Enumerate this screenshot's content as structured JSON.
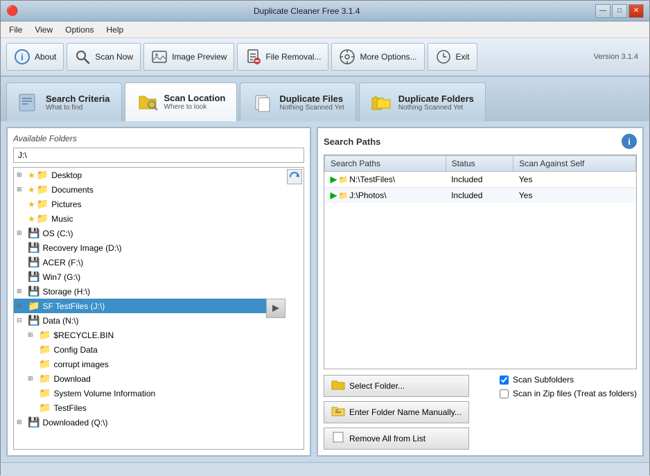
{
  "window": {
    "title": "Duplicate Cleaner Free 3.1.4",
    "version": "Version 3.1.4"
  },
  "titlebar": {
    "icon": "🔴",
    "minimize": "—",
    "maximize": "□",
    "close": "✕"
  },
  "menubar": {
    "items": [
      "File",
      "View",
      "Options",
      "Help"
    ]
  },
  "toolbar": {
    "buttons": [
      {
        "id": "about",
        "icon": "ℹ",
        "label": "About"
      },
      {
        "id": "scan-now",
        "icon": "🔍",
        "label": "Scan Now"
      },
      {
        "id": "image-preview",
        "icon": "🖼",
        "label": "Image Preview"
      },
      {
        "id": "file-removal",
        "icon": "🗑",
        "label": "File Removal..."
      },
      {
        "id": "more-options",
        "icon": "⚙",
        "label": "More Options..."
      },
      {
        "id": "exit",
        "icon": "⏻",
        "label": "Exit"
      }
    ],
    "version": "Version 3.1.4"
  },
  "tabs": [
    {
      "id": "search-criteria",
      "icon": "🖥",
      "title": "Search Criteria",
      "sub": "What to find",
      "active": false
    },
    {
      "id": "scan-location",
      "icon": "📁",
      "title": "Scan Location",
      "sub": "Where to look",
      "active": true
    },
    {
      "id": "duplicate-files",
      "icon": "📄",
      "title": "Duplicate Files",
      "sub": "Nothing Scanned Yet",
      "active": false
    },
    {
      "id": "duplicate-folders",
      "icon": "📂",
      "title": "Duplicate Folders",
      "sub": "Nothing Scanned Yet",
      "active": false
    }
  ],
  "left_panel": {
    "title": "Available Folders",
    "path_value": "J:\\",
    "tree": [
      {
        "id": "desktop",
        "indent": 0,
        "expand": "⊞",
        "icon": "⭐📁",
        "label": "Desktop",
        "selected": false
      },
      {
        "id": "documents",
        "indent": 0,
        "expand": "⊞",
        "icon": "⭐📁",
        "label": "Documents",
        "selected": false
      },
      {
        "id": "pictures",
        "indent": 0,
        "expand": " ",
        "icon": "⭐📁",
        "label": "Pictures",
        "selected": false
      },
      {
        "id": "music",
        "indent": 0,
        "expand": " ",
        "icon": "⭐📁",
        "label": "Music",
        "selected": false
      },
      {
        "id": "os-c",
        "indent": 0,
        "expand": "⊞",
        "icon": "💾",
        "label": "OS (C:\\)",
        "selected": false
      },
      {
        "id": "recovery-d",
        "indent": 0,
        "expand": " ",
        "icon": "💾",
        "label": "Recovery Image (D:\\)",
        "selected": false
      },
      {
        "id": "acer-f",
        "indent": 0,
        "expand": " ",
        "icon": "💾",
        "label": "ACER (F:\\)",
        "selected": false
      },
      {
        "id": "win7-g",
        "indent": 0,
        "expand": " ",
        "icon": "💾",
        "label": "Win7 (G:\\)",
        "selected": false
      },
      {
        "id": "storage-h",
        "indent": 0,
        "expand": "⊞",
        "icon": "💾",
        "label": "Storage (H:\\)",
        "selected": false
      },
      {
        "id": "sf-testfiles-j",
        "indent": 0,
        "expand": "⊟",
        "icon": "📁",
        "label": "SF TestFiles (J:\\)",
        "selected": true
      },
      {
        "id": "data-n",
        "indent": 0,
        "expand": "⊟",
        "icon": "💾",
        "label": "Data (N:\\)",
        "selected": false
      },
      {
        "id": "recycle-bin",
        "indent": 1,
        "expand": "⊞",
        "icon": "📁",
        "label": "$RECYCLE.BIN",
        "selected": false
      },
      {
        "id": "config-data",
        "indent": 1,
        "expand": " ",
        "icon": "📁",
        "label": "Config Data",
        "selected": false
      },
      {
        "id": "corrupt-images",
        "indent": 1,
        "expand": " ",
        "icon": "📁",
        "label": "corrupt images",
        "selected": false
      },
      {
        "id": "download",
        "indent": 1,
        "expand": "⊞",
        "icon": "📁",
        "label": "Download",
        "selected": false
      },
      {
        "id": "system-volume",
        "indent": 1,
        "expand": " ",
        "icon": "📁",
        "label": "System Volume Information",
        "selected": false
      },
      {
        "id": "testfiles",
        "indent": 1,
        "expand": " ",
        "icon": "📁",
        "label": "TestFiles",
        "selected": false
      },
      {
        "id": "downloaded-q",
        "indent": 0,
        "expand": "⊞",
        "icon": "💾",
        "label": "Downloaded (Q:\\)",
        "selected": false
      }
    ]
  },
  "right_panel": {
    "title": "Search Paths",
    "table": {
      "headers": [
        "Search Paths",
        "Status",
        "Scan Against Self"
      ],
      "rows": [
        {
          "path": "N:\\TestFiles\\",
          "status": "Included",
          "scan_self": "Yes"
        },
        {
          "path": "J:\\Photos\\",
          "status": "Included",
          "scan_self": "Yes"
        }
      ]
    },
    "buttons": [
      {
        "id": "select-folder",
        "icon": "📁",
        "label": "Select Folder..."
      },
      {
        "id": "enter-folder-manually",
        "icon": "✏",
        "label": "Enter Folder Name Manually..."
      },
      {
        "id": "remove-all",
        "icon": "📄",
        "label": "Remove All from List"
      }
    ],
    "options": [
      {
        "id": "scan-subfolders",
        "label": "Scan Subfolders",
        "checked": true
      },
      {
        "id": "scan-zip",
        "label": "Scan in Zip files (Treat as folders)",
        "checked": false
      }
    ]
  },
  "status_bar": {
    "text": ""
  }
}
